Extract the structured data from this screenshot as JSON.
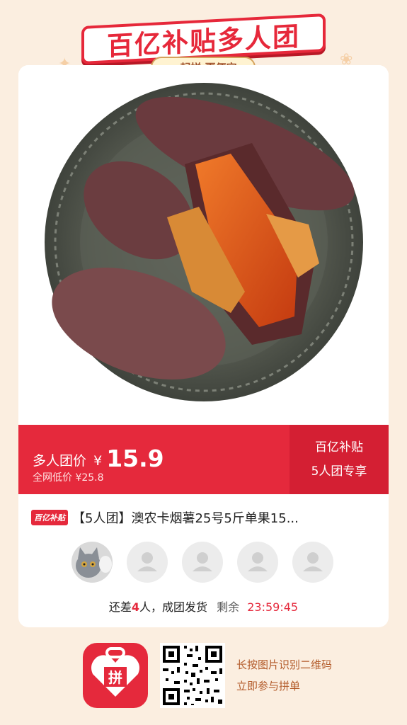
{
  "banner": {
    "title": "百亿补贴多人团",
    "subtitle": "一起拼 更便宜"
  },
  "price": {
    "label": "多人团价",
    "currency": "¥",
    "value": "15.9",
    "original": "全网低价 ¥25.8"
  },
  "promo": {
    "line1": "百亿补贴",
    "line2": "5人团专享"
  },
  "product": {
    "tag": "百亿补贴",
    "title": "【5人团】澳农卡烟薯25号5斤单果15..."
  },
  "group": {
    "status_prefix": "还差",
    "missing_count": "4",
    "status_suffix": "人，成团发货",
    "remain_label": "剩余",
    "remain_time": "23:59:45"
  },
  "footer": {
    "logo_icon": "pinduoduo-logo-icon",
    "logo_char": "拼",
    "line1": "长按图片识别二维码",
    "line2": "立即参与拼单"
  },
  "colors": {
    "accent": "#e5293c",
    "background": "#fbeee0"
  }
}
